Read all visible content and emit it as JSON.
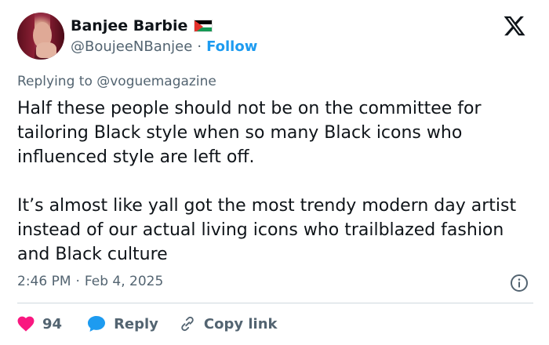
{
  "user": {
    "display_name": "Banjee Barbie",
    "handle": "@BoujeeNBanjee",
    "separator": "·",
    "follow_label": "Follow"
  },
  "reply": {
    "prefix": "Replying to",
    "mention": "@voguemagazine"
  },
  "tweet": {
    "paragraph_1": "Half these people should not be on the committee for tailoring Black style when so many Black icons who influenced style are left off.",
    "paragraph_2": "It’s almost like yall got the most trendy modern day artist instead of our actual living icons who trailblazed fashion and Black culture"
  },
  "meta": {
    "time": "2:46 PM",
    "separator": "·",
    "date": "Feb 4, 2025"
  },
  "actions": {
    "like_count": "94",
    "reply_label": "Reply",
    "copy_label": "Copy link"
  },
  "icons": {
    "brand": "x-logo-icon",
    "flag": "palestine-flag-icon",
    "like": "heart-icon",
    "reply": "speech-bubble-icon",
    "copy": "link-icon",
    "info": "info-icon"
  },
  "colors": {
    "text": "#0f1419",
    "secondary": "#536471",
    "accent": "#1d9bf0",
    "like": "#f91880",
    "divider": "#cfd9de"
  }
}
